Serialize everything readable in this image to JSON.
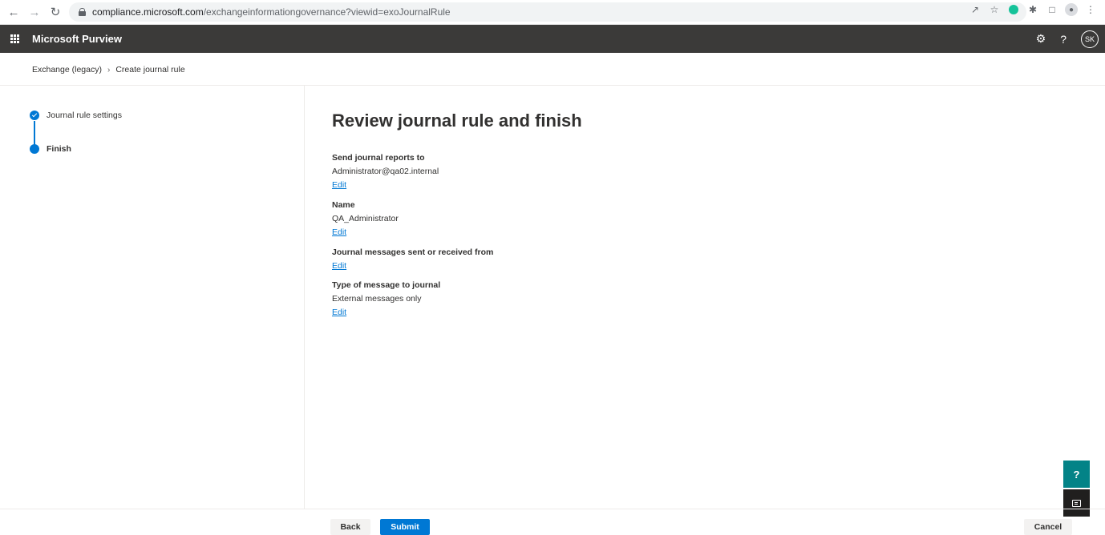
{
  "browser": {
    "url_host": "compliance.microsoft.com",
    "url_path": "/exchangeinformationgovernance?viewid=exoJournalRule"
  },
  "suite": {
    "app_title": "Microsoft Purview",
    "avatar_initials": "SK",
    "help_glyph": "?"
  },
  "breadcrumb": {
    "parent": "Exchange (legacy)",
    "current": "Create journal rule"
  },
  "steps": [
    {
      "label": "Journal rule settings",
      "state": "completed"
    },
    {
      "label": "Finish",
      "state": "current"
    }
  ],
  "main": {
    "title": "Review journal rule and finish",
    "fields": [
      {
        "label": "Send journal reports to",
        "value": "Administrator@qa02.internal",
        "edit": "Edit"
      },
      {
        "label": "Name",
        "value": "QA_Administrator",
        "edit": "Edit"
      },
      {
        "label": "Journal messages sent or received from",
        "value": "",
        "edit": "Edit"
      },
      {
        "label": "Type of message to journal",
        "value": "External messages only",
        "edit": "Edit"
      }
    ]
  },
  "footer": {
    "back_label": "Back",
    "submit_label": "Submit",
    "cancel_label": "Cancel"
  },
  "floating": {
    "help_glyph": "?"
  },
  "colors": {
    "accent": "#0078d4",
    "suitebar": "#3b3a39",
    "help_button": "#038387",
    "feedback_button": "#201f1e"
  }
}
